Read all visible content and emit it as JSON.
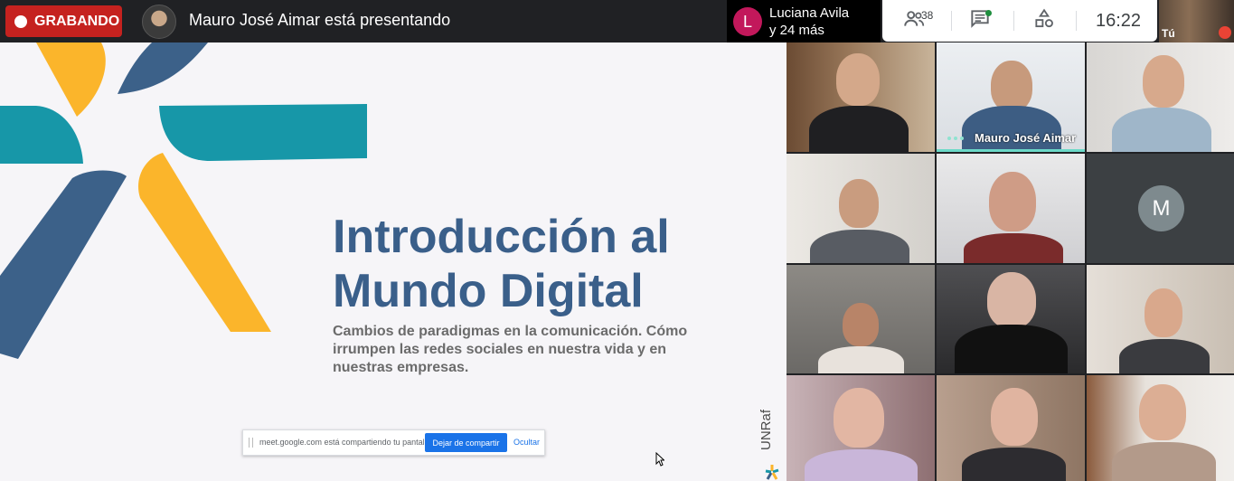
{
  "topbar": {
    "recording_label": "GRABANDO",
    "presenting_text": "Mauro José Aimar está presentando",
    "join_notice": {
      "avatar_letter": "L",
      "line1": "Luciana Avila",
      "line2": "y 24 más"
    },
    "participants_count": "38",
    "clock": "16:22",
    "self_label": "Tú"
  },
  "slide": {
    "title_line1": "Introducción al",
    "title_line2": "Mundo Digital",
    "subtitle": "Cambios de paradigmas en la comunicación. Cómo irrumpen las redes sociales en nuestra vida y en nuestras empresas.",
    "brand": "UNRaf",
    "colors": {
      "yellow": "#fbb52b",
      "teal": "#1797a8",
      "blue": "#3c6189",
      "title": "#3a5f8a"
    }
  },
  "share_bar": {
    "message": "meet.google.com está compartiendo tu pantalla.",
    "stop_label": "Dejar de compartir",
    "hide_label": "Ocultar"
  },
  "grid": {
    "presenter_name": "Mauro José Aimar",
    "avatar_letter": "M"
  }
}
